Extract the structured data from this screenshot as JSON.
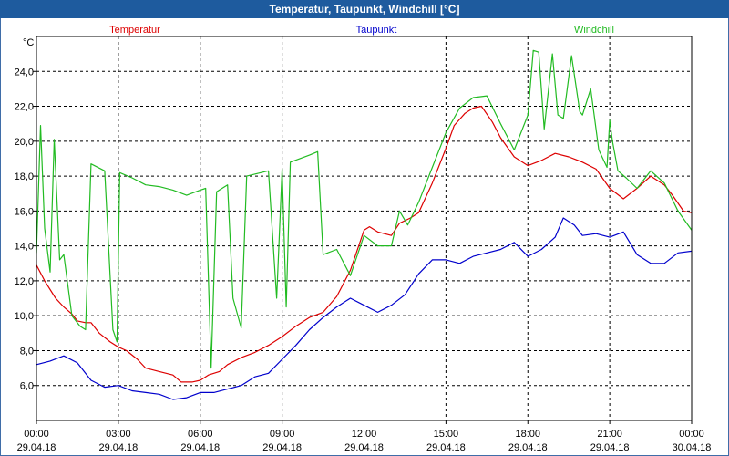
{
  "window": {
    "title": "Temperatur, Taupunkt, Windchill [°C]"
  },
  "chart_data": {
    "type": "line",
    "title": "Temperatur, Taupunkt, Windchill [°C]",
    "yunit": "°C",
    "ylim": [
      4.0,
      26.0
    ],
    "yticks": [
      "6,0",
      "8,0",
      "10,0",
      "12,0",
      "14,0",
      "16,0",
      "18,0",
      "20,0",
      "22,0",
      "24,0"
    ],
    "xlim": [
      0,
      24
    ],
    "xticks": [
      {
        "time": "00:00",
        "date": "29.04.18"
      },
      {
        "time": "03:00",
        "date": "29.04.18"
      },
      {
        "time": "06:00",
        "date": "29.04.18"
      },
      {
        "time": "09:00",
        "date": "29.04.18"
      },
      {
        "time": "12:00",
        "date": "29.04.18"
      },
      {
        "time": "15:00",
        "date": "29.04.18"
      },
      {
        "time": "18:00",
        "date": "29.04.18"
      },
      {
        "time": "21:00",
        "date": "29.04.18"
      },
      {
        "time": "00:00",
        "date": "30.04.18"
      }
    ],
    "grid": true,
    "legend": "top",
    "series": [
      {
        "name": "Temperatur",
        "color": "#dd0000",
        "points": [
          [
            0.0,
            12.9
          ],
          [
            0.3,
            12.0
          ],
          [
            0.7,
            11.0
          ],
          [
            1.0,
            10.5
          ],
          [
            1.3,
            10.1
          ],
          [
            1.5,
            9.7
          ],
          [
            1.8,
            9.6
          ],
          [
            2.0,
            9.6
          ],
          [
            2.3,
            9.0
          ],
          [
            2.7,
            8.5
          ],
          [
            3.0,
            8.2
          ],
          [
            3.3,
            8.0
          ],
          [
            3.7,
            7.5
          ],
          [
            4.0,
            7.0
          ],
          [
            4.5,
            6.8
          ],
          [
            5.0,
            6.6
          ],
          [
            5.3,
            6.2
          ],
          [
            5.7,
            6.2
          ],
          [
            6.0,
            6.3
          ],
          [
            6.3,
            6.6
          ],
          [
            6.7,
            6.8
          ],
          [
            7.0,
            7.2
          ],
          [
            7.5,
            7.6
          ],
          [
            8.0,
            7.9
          ],
          [
            8.5,
            8.3
          ],
          [
            9.0,
            8.8
          ],
          [
            9.5,
            9.4
          ],
          [
            10.0,
            9.9
          ],
          [
            10.5,
            10.2
          ],
          [
            11.0,
            11.1
          ],
          [
            11.5,
            12.6
          ],
          [
            12.0,
            14.9
          ],
          [
            12.2,
            15.1
          ],
          [
            12.5,
            14.8
          ],
          [
            13.0,
            14.6
          ],
          [
            13.3,
            15.3
          ],
          [
            13.7,
            15.6
          ],
          [
            14.0,
            15.9
          ],
          [
            14.5,
            17.6
          ],
          [
            15.0,
            19.6
          ],
          [
            15.3,
            20.9
          ],
          [
            15.7,
            21.6
          ],
          [
            16.0,
            21.9
          ],
          [
            16.3,
            22.0
          ],
          [
            16.7,
            21.1
          ],
          [
            17.0,
            20.2
          ],
          [
            17.5,
            19.1
          ],
          [
            18.0,
            18.6
          ],
          [
            18.5,
            18.9
          ],
          [
            19.0,
            19.3
          ],
          [
            19.5,
            19.1
          ],
          [
            20.0,
            18.8
          ],
          [
            20.5,
            18.4
          ],
          [
            21.0,
            17.3
          ],
          [
            21.5,
            16.7
          ],
          [
            22.0,
            17.3
          ],
          [
            22.5,
            18.0
          ],
          [
            23.0,
            17.5
          ],
          [
            23.3,
            16.9
          ],
          [
            23.7,
            16.0
          ],
          [
            24.0,
            15.9
          ]
        ]
      },
      {
        "name": "Taupunkt",
        "color": "#0000cc",
        "points": [
          [
            0.0,
            7.2
          ],
          [
            0.5,
            7.4
          ],
          [
            1.0,
            7.7
          ],
          [
            1.5,
            7.3
          ],
          [
            2.0,
            6.3
          ],
          [
            2.5,
            5.9
          ],
          [
            3.0,
            6.0
          ],
          [
            3.5,
            5.7
          ],
          [
            4.0,
            5.6
          ],
          [
            4.5,
            5.5
          ],
          [
            5.0,
            5.2
          ],
          [
            5.5,
            5.3
          ],
          [
            6.0,
            5.6
          ],
          [
            6.5,
            5.6
          ],
          [
            7.0,
            5.8
          ],
          [
            7.5,
            6.0
          ],
          [
            8.0,
            6.5
          ],
          [
            8.5,
            6.7
          ],
          [
            9.0,
            7.5
          ],
          [
            9.5,
            8.3
          ],
          [
            10.0,
            9.2
          ],
          [
            10.5,
            9.9
          ],
          [
            11.0,
            10.5
          ],
          [
            11.5,
            11.0
          ],
          [
            12.0,
            10.6
          ],
          [
            12.5,
            10.2
          ],
          [
            13.0,
            10.6
          ],
          [
            13.5,
            11.2
          ],
          [
            14.0,
            12.4
          ],
          [
            14.5,
            13.2
          ],
          [
            15.0,
            13.2
          ],
          [
            15.5,
            13.0
          ],
          [
            16.0,
            13.4
          ],
          [
            16.5,
            13.6
          ],
          [
            17.0,
            13.8
          ],
          [
            17.5,
            14.2
          ],
          [
            18.0,
            13.4
          ],
          [
            18.5,
            13.8
          ],
          [
            19.0,
            14.5
          ],
          [
            19.3,
            15.6
          ],
          [
            19.7,
            15.2
          ],
          [
            20.0,
            14.6
          ],
          [
            20.5,
            14.7
          ],
          [
            21.0,
            14.5
          ],
          [
            21.5,
            14.8
          ],
          [
            22.0,
            13.5
          ],
          [
            22.5,
            13.0
          ],
          [
            23.0,
            13.0
          ],
          [
            23.5,
            13.6
          ],
          [
            24.0,
            13.7
          ]
        ]
      },
      {
        "name": "Windchill",
        "color": "#22bb22",
        "points": [
          [
            0.0,
            13.6
          ],
          [
            0.15,
            20.9
          ],
          [
            0.3,
            15.0
          ],
          [
            0.5,
            12.5
          ],
          [
            0.65,
            20.1
          ],
          [
            0.85,
            13.2
          ],
          [
            1.0,
            13.5
          ],
          [
            1.3,
            10.0
          ],
          [
            1.6,
            9.4
          ],
          [
            1.8,
            9.2
          ],
          [
            2.0,
            18.7
          ],
          [
            2.5,
            18.3
          ],
          [
            2.8,
            9.2
          ],
          [
            2.95,
            8.5
          ],
          [
            3.05,
            18.2
          ],
          [
            3.5,
            17.9
          ],
          [
            4.0,
            17.5
          ],
          [
            4.5,
            17.4
          ],
          [
            5.0,
            17.2
          ],
          [
            5.5,
            16.9
          ],
          [
            6.0,
            17.2
          ],
          [
            6.2,
            17.3
          ],
          [
            6.4,
            7.0
          ],
          [
            6.6,
            17.1
          ],
          [
            7.0,
            17.5
          ],
          [
            7.2,
            11.0
          ],
          [
            7.5,
            9.3
          ],
          [
            7.7,
            18.0
          ],
          [
            8.5,
            18.3
          ],
          [
            8.8,
            11.0
          ],
          [
            9.0,
            18.4
          ],
          [
            9.15,
            10.5
          ],
          [
            9.3,
            18.8
          ],
          [
            10.0,
            19.2
          ],
          [
            10.3,
            19.4
          ],
          [
            10.5,
            13.5
          ],
          [
            11.0,
            13.8
          ],
          [
            11.5,
            12.3
          ],
          [
            12.0,
            14.6
          ],
          [
            12.5,
            14.0
          ],
          [
            13.0,
            14.0
          ],
          [
            13.3,
            16.0
          ],
          [
            13.6,
            15.2
          ],
          [
            14.0,
            16.5
          ],
          [
            14.5,
            18.5
          ],
          [
            15.0,
            20.5
          ],
          [
            15.5,
            21.9
          ],
          [
            16.0,
            22.5
          ],
          [
            16.5,
            22.6
          ],
          [
            17.0,
            21.0
          ],
          [
            17.5,
            19.5
          ],
          [
            18.0,
            21.5
          ],
          [
            18.2,
            25.2
          ],
          [
            18.4,
            25.1
          ],
          [
            18.6,
            20.7
          ],
          [
            18.9,
            25.0
          ],
          [
            19.1,
            21.5
          ],
          [
            19.3,
            21.3
          ],
          [
            19.6,
            24.9
          ],
          [
            19.9,
            21.7
          ],
          [
            20.0,
            21.5
          ],
          [
            20.3,
            23.0
          ],
          [
            20.6,
            19.5
          ],
          [
            20.9,
            18.5
          ],
          [
            21.0,
            21.2
          ],
          [
            21.1,
            20.0
          ],
          [
            21.3,
            18.3
          ],
          [
            21.6,
            17.9
          ],
          [
            22.0,
            17.3
          ],
          [
            22.5,
            18.3
          ],
          [
            23.0,
            17.6
          ],
          [
            23.5,
            16.0
          ],
          [
            24.0,
            14.9
          ]
        ]
      }
    ]
  }
}
